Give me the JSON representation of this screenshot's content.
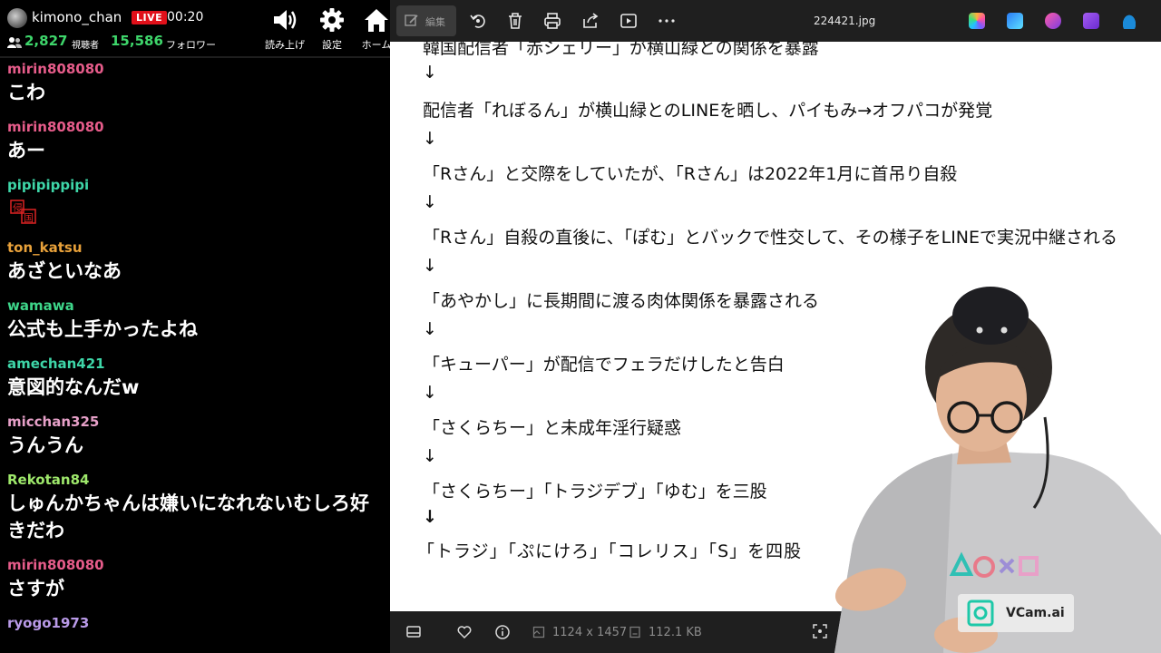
{
  "stream": {
    "channel": "kimono_chan",
    "live_label": "LIVE",
    "elapsed": "00:20",
    "viewers": "2,827",
    "viewers_label": "視聴者",
    "followers": "15,586",
    "followers_label": "フォロワー",
    "buttons": [
      {
        "label": "読み上げ",
        "icon": "speaker-icon"
      },
      {
        "label": "設定",
        "icon": "gear-icon"
      },
      {
        "label": "ホーム",
        "icon": "home-icon"
      }
    ]
  },
  "chat": [
    {
      "user": "mirin808080",
      "color": "#e65c8a",
      "text": "こわ"
    },
    {
      "user": "mirin808080",
      "color": "#e65c8a",
      "text": "あー"
    },
    {
      "user": "pipipippipi",
      "color": "#3ed6a8",
      "text": "",
      "stamp": "stamp-icon"
    },
    {
      "user": "ton_katsu",
      "color": "#e8a13a",
      "text": "あざといなあ"
    },
    {
      "user": "wamawa",
      "color": "#3ed68a",
      "text": "公式も上手かったよね"
    },
    {
      "user": "amechan421",
      "color": "#3ed6a8",
      "text": "意図的なんだw"
    },
    {
      "user": "micchan325",
      "color": "#e6a0c8",
      "text": "うんうん"
    },
    {
      "user": "Rekotan84",
      "color": "#9ee86b",
      "text": "しゅんかちゃんは嫌いになれないむしろ好きだわ"
    },
    {
      "user": "mirin808080",
      "color": "#e65c8a",
      "text": "さすが"
    },
    {
      "user": "ryogo1973",
      "color": "#b99ae8",
      "text": ""
    }
  ],
  "viewer": {
    "edit_label": "編集",
    "file_name": "224421.jpg",
    "dimensions": "1124 x 1457",
    "file_size": "112.1 KB",
    "toolbar_icons": [
      "rotate-icon",
      "delete-icon",
      "print-icon",
      "share-icon",
      "slideshow-icon",
      "more-icon"
    ],
    "app_icons": [
      {
        "name": "copilot-icon",
        "color": "#5b8cff"
      },
      {
        "name": "designer-icon",
        "color": "#2a7cf6"
      },
      {
        "name": "clipchamp-icon",
        "color": "#c43cc8"
      },
      {
        "name": "onenote-icon",
        "color": "#8a3ce0"
      },
      {
        "name": "onedrive-icon",
        "color": "#1b8ad8"
      }
    ]
  },
  "document": {
    "lines": [
      "韓国配信者「赤シェリー」が横山緑との関係を暴露",
      "↓",
      "配信者「れぼるん」が横山緑とのLINEを晒し、パイもみ→オフパコが発覚",
      "↓",
      "「Rさん」と交際をしていたが、「Rさん」は2022年1月に首吊り自殺",
      "↓",
      "「Rさん」自殺の直後に、「ぽむ」とバックで性交して、その様子をLINEで実況中継される",
      "↓",
      "「あやかし」に長期間に渡る肉体関係を暴露される",
      "↓",
      "「キューパー」が配信でフェラだけしたと告白",
      "↓",
      "「さくらちー」と未成年淫行疑惑",
      "↓",
      "「さくらちー」「トラジデブ」「ゆむ」を三股",
      "↓",
      "「トラジ」「ぷにけろ」「コレリス」「S」を四股"
    ]
  },
  "overlay": {
    "brand": "VCam.ai"
  }
}
